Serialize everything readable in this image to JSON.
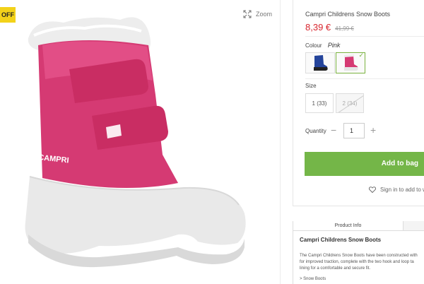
{
  "gallery": {
    "badge": "OFF",
    "zoom_label": "Zoom",
    "image_icon": "pink-snow-boot"
  },
  "product": {
    "title": "Campri Childrens Snow Boots",
    "price_now": "8,39 €",
    "price_was": "41,99 €",
    "colors": {
      "price": "#d8262f",
      "accent": "#74b648",
      "badge": "#f3d21a"
    }
  },
  "colour": {
    "label": "Colour",
    "value": "Pink",
    "swatches": [
      {
        "name": "navy-boot",
        "selected": false
      },
      {
        "name": "pink-boot",
        "selected": true
      }
    ]
  },
  "size": {
    "label": "Size",
    "options": [
      {
        "label": "1 (33)",
        "available": true
      },
      {
        "label": "2 (34)",
        "available": false
      }
    ]
  },
  "quantity": {
    "label": "Quantity",
    "value": "1",
    "minus": "−",
    "plus": "+"
  },
  "actions": {
    "add_to_bag": "Add to bag",
    "wishlist": "Sign in to add to w"
  },
  "info": {
    "tab_label": "Product Info",
    "title": "Campri Childrens Snow Boots",
    "desc_lines": [
      "The Campri Childrens Snow Boots have been constructed with",
      "for improved traction, complete with the two hook and loop ta",
      "lining for a comfortable and secure fit."
    ],
    "link": "> Snow Boots"
  }
}
